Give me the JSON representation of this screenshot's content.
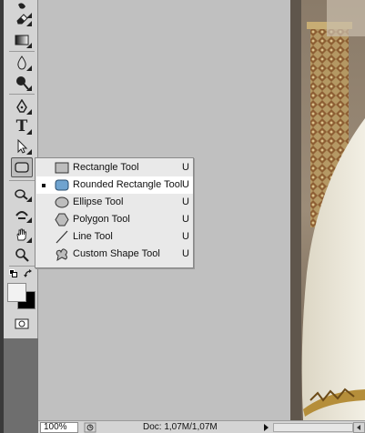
{
  "toolbar": {
    "tools": [
      {
        "name": "blur-tool",
        "icon": "blur-drop-icon"
      },
      {
        "name": "eraser-tool",
        "icon": "eraser-icon"
      },
      {
        "name": "gradient-tool",
        "icon": "gradient-icon"
      },
      {
        "name": "blur-drop-tool",
        "icon": "drop-icon"
      },
      {
        "name": "dodge-tool",
        "icon": "dodge-icon"
      },
      {
        "name": "pen-tool",
        "icon": "pen-icon"
      },
      {
        "name": "type-tool",
        "icon": "type-icon",
        "glyph": "T"
      },
      {
        "name": "path-selection-tool",
        "icon": "arrow-icon"
      },
      {
        "name": "shape-tool",
        "icon": "rounded-rectangle-icon"
      },
      {
        "name": "3d-rotate-tool",
        "icon": "3d-rotate-icon"
      },
      {
        "name": "3d-orbit-tool",
        "icon": "3d-orbit-icon"
      },
      {
        "name": "hand-tool",
        "icon": "hand-icon"
      },
      {
        "name": "zoom-tool",
        "icon": "zoom-icon"
      }
    ]
  },
  "flyout": {
    "items": [
      {
        "label": "Rectangle Tool",
        "key": "U",
        "icon": "rectangle-icon",
        "selected": false
      },
      {
        "label": "Rounded Rectangle Tool",
        "key": "U",
        "icon": "rounded-rectangle-icon",
        "selected": true
      },
      {
        "label": "Ellipse Tool",
        "key": "U",
        "icon": "ellipse-icon",
        "selected": false
      },
      {
        "label": "Polygon Tool",
        "key": "U",
        "icon": "polygon-icon",
        "selected": false
      },
      {
        "label": "Line Tool",
        "key": "U",
        "icon": "line-icon",
        "selected": false
      },
      {
        "label": "Custom Shape Tool",
        "key": "U",
        "icon": "custom-shape-icon",
        "selected": false
      }
    ]
  },
  "status": {
    "zoom": "100%",
    "doc": "Doc: 1,07M/1,07M"
  },
  "colors": {
    "panel": "#d4d4d4",
    "canvas": "#c0c0c0",
    "menu": "#e9e9e9",
    "selected_item": "#ffffff"
  }
}
